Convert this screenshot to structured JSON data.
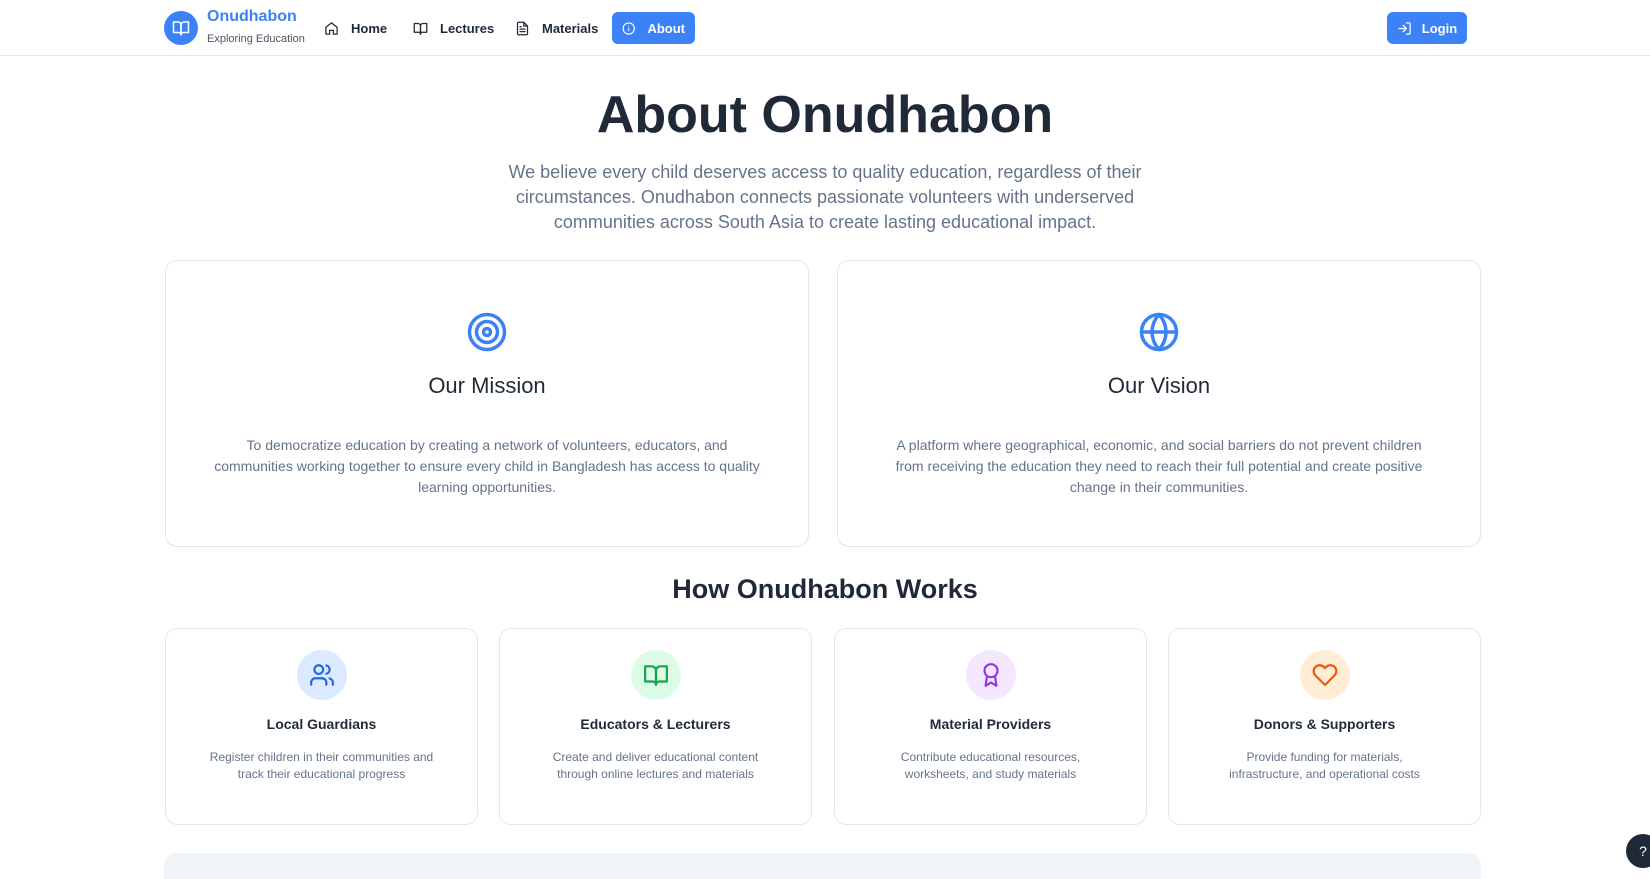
{
  "brand": {
    "name": "Onudhabon",
    "tagline": "Exploring Education",
    "color": "#3b82f6"
  },
  "nav": {
    "items": [
      {
        "label": "Home",
        "icon": "home-icon",
        "active": false
      },
      {
        "label": "Lectures",
        "icon": "book-open-icon",
        "active": false
      },
      {
        "label": "Materials",
        "icon": "file-text-icon",
        "active": false
      },
      {
        "label": "About",
        "icon": "info-icon",
        "active": true
      }
    ],
    "login_label": "Login"
  },
  "hero": {
    "title": "About Onudhabon",
    "description": "We believe every child deserves access to quality education, regardless of their circumstances. Onudhabon connects passionate volunteers with underserved communities across South Asia to create lasting educational impact."
  },
  "mission": {
    "title": "Our Mission",
    "icon": "target-icon",
    "text": "To democratize education by creating a network of volunteers, educators, and communities working together to ensure every child in Bangladesh has access to quality learning opportunities."
  },
  "vision": {
    "title": "Our Vision",
    "icon": "globe-icon",
    "text": "A platform where geographical, economic, and social barriers do not prevent children from receiving the education they need to reach their full potential and create positive change in their communities."
  },
  "how_it_works": {
    "title": "How Onudhabon Works",
    "roles": [
      {
        "name": "Local Guardians",
        "icon": "users-icon",
        "color": "#2563eb",
        "bg": "#dbeafe",
        "text": "Register children in their communities and track their educational progress"
      },
      {
        "name": "Educators & Lecturers",
        "icon": "book-open-icon",
        "color": "#16a34a",
        "bg": "#dcfce7",
        "text": "Create and deliver educational content through online lectures and materials"
      },
      {
        "name": "Material Providers",
        "icon": "award-icon",
        "color": "#9333ea",
        "bg": "#f3e8ff",
        "text": "Contribute educational resources, worksheets, and study materials"
      },
      {
        "name": "Donors & Supporters",
        "icon": "heart-icon",
        "color": "#ea580c",
        "bg": "#ffedd5",
        "text": "Provide funding for materials, infrastructure, and operational costs"
      }
    ]
  },
  "help": {
    "label": "?"
  }
}
